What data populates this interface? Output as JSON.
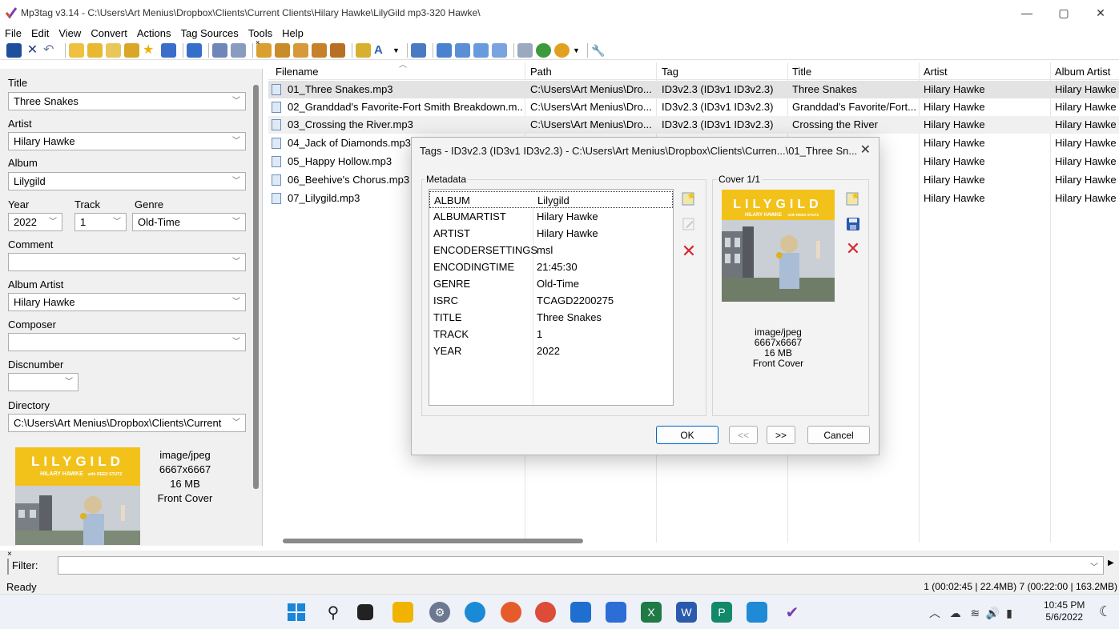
{
  "window": {
    "title": "Mp3tag v3.14  -  C:\\Users\\Art Menius\\Dropbox\\Clients\\Current Clients\\Hilary Hawke\\LilyGild mp3-320 Hawke\\",
    "minimize": "—",
    "maximize": "▢",
    "close": "✕"
  },
  "menu": [
    "File",
    "Edit",
    "View",
    "Convert",
    "Actions",
    "Tag Sources",
    "Tools",
    "Help"
  ],
  "left_panel": {
    "title_label": "Title",
    "title_value": "Three Snakes",
    "artist_label": "Artist",
    "artist_value": "Hilary Hawke",
    "album_label": "Album",
    "album_value": "Lilygild",
    "year_label": "Year",
    "year_value": "2022",
    "track_label": "Track",
    "track_value": "1",
    "genre_label": "Genre",
    "genre_value": "Old-Time",
    "comment_label": "Comment",
    "comment_value": "",
    "album_artist_label": "Album Artist",
    "album_artist_value": "Hilary Hawke",
    "composer_label": "Composer",
    "composer_value": "",
    "discnumber_label": "Discnumber",
    "discnumber_value": "",
    "directory_label": "Directory",
    "directory_value": "C:\\Users\\Art Menius\\Dropbox\\Clients\\Current",
    "cover_mime": "image/jpeg",
    "cover_size": "6667x6667",
    "cover_filesize": "16 MB",
    "cover_type": "Front Cover",
    "close_mark": "×"
  },
  "cover_art": {
    "title": "LILYGILD",
    "subtitle": "HILARY HAWKE",
    "with": "with REED STUTZ"
  },
  "file_list": {
    "columns": [
      "Filename",
      "Path",
      "Tag",
      "Title",
      "Artist",
      "Album Artist"
    ],
    "rows": [
      {
        "filename": "01_Three Snakes.mp3",
        "path": "C:\\Users\\Art Menius\\Dro...",
        "tag": "ID3v2.3 (ID3v1 ID3v2.3)",
        "title": "Three Snakes",
        "artist": "Hilary Hawke",
        "album_artist": "Hilary Hawke"
      },
      {
        "filename": "02_Granddad's Favorite-Fort Smith Breakdown.m...",
        "path": "C:\\Users\\Art Menius\\Dro...",
        "tag": "ID3v2.3 (ID3v1 ID3v2.3)",
        "title": "Granddad's Favorite/Fort...",
        "artist": "Hilary Hawke",
        "album_artist": "Hilary Hawke"
      },
      {
        "filename": "03_Crossing the River.mp3",
        "path": "C:\\Users\\Art Menius\\Dro...",
        "tag": "ID3v2.3 (ID3v1 ID3v2.3)",
        "title": "Crossing the River",
        "artist": "Hilary Hawke",
        "album_artist": "Hilary Hawke"
      },
      {
        "filename": "04_Jack of Diamonds.mp3",
        "path": "",
        "tag": "",
        "title": "",
        "artist": "Hilary Hawke",
        "album_artist": "Hilary Hawke"
      },
      {
        "filename": "05_Happy Hollow.mp3",
        "path": "",
        "tag": "",
        "title": "",
        "artist": "Hilary Hawke",
        "album_artist": "Hilary Hawke"
      },
      {
        "filename": "06_Beehive's Chorus.mp3",
        "path": "",
        "tag": "",
        "title": "",
        "artist": "Hilary Hawke",
        "album_artist": "Hilary Hawke"
      },
      {
        "filename": "07_Lilygild.mp3",
        "path": "",
        "tag": "",
        "title": "",
        "artist": "Hilary Hawke",
        "album_artist": "Hilary Hawke"
      }
    ]
  },
  "filter": {
    "label": "Filter:",
    "value": ""
  },
  "status": {
    "left": "Ready",
    "right": "1 (00:02:45 | 22.4MB)   7 (00:22:00 | 163.2MB)"
  },
  "dialog": {
    "title": "Tags - ID3v2.3 (ID3v1 ID3v2.3) - C:\\Users\\Art Menius\\Dropbox\\Clients\\Curren...\\01_Three Sn...",
    "close": "✕",
    "metadata_label": "Metadata",
    "cover_label": "Cover 1/1",
    "metadata": [
      {
        "key": "ALBUM",
        "value": "Lilygild"
      },
      {
        "key": "ALBUMARTIST",
        "value": "Hilary Hawke"
      },
      {
        "key": "ARTIST",
        "value": "Hilary Hawke"
      },
      {
        "key": "ENCODERSETTINGS",
        "value": "msl"
      },
      {
        "key": "ENCODINGTIME",
        "value": "21:45:30"
      },
      {
        "key": "GENRE",
        "value": "Old-Time"
      },
      {
        "key": "ISRC",
        "value": "TCAGD2200275"
      },
      {
        "key": "TITLE",
        "value": "Three Snakes"
      },
      {
        "key": "TRACK",
        "value": "1"
      },
      {
        "key": "YEAR",
        "value": "2022"
      }
    ],
    "cover_mime": "image/jpeg",
    "cover_size": "6667x6667",
    "cover_filesize": "16 MB",
    "cover_type": "Front Cover",
    "ok": "OK",
    "prev": "<<",
    "next": ">>",
    "cancel": "Cancel"
  },
  "taskbar": {
    "time": "10:45 PM",
    "date": "5/6/2022"
  },
  "colors": {
    "cover_gold": "#f2c21b",
    "accent_blue": "#0067c0",
    "delete_red": "#d8262b",
    "selected_row": "#e3e3e3"
  }
}
